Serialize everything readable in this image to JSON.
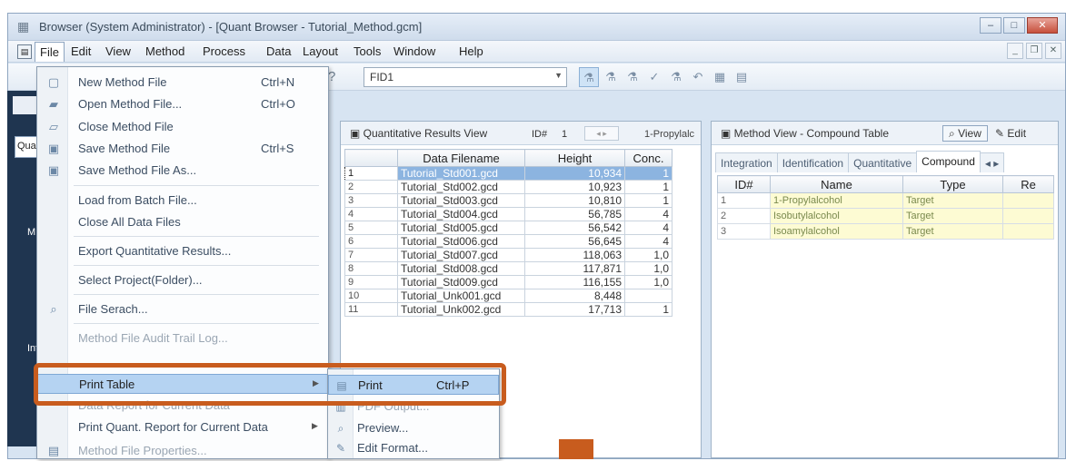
{
  "window": {
    "title": "Browser (System Administrator) - [Quant Browser - Tutorial_Method.gcm]"
  },
  "menubar": [
    "File",
    "Edit",
    "View",
    "Method",
    "Process",
    "Data",
    "Layout",
    "Tools",
    "Window",
    "Help"
  ],
  "toolbar": {
    "detector_value": "FID1"
  },
  "left_panel": {
    "labels": [
      "Qua",
      "M",
      "Int"
    ]
  },
  "results_view": {
    "title": "Quantitative Results View",
    "id_label": "ID#",
    "id_value": "1",
    "target": "1-Propylalc",
    "columns": [
      "Data Filename",
      "Height",
      "Conc."
    ],
    "rows": [
      {
        "n": "1",
        "file": "Tutorial_Std001.gcd",
        "height": "10,934",
        "conc": "1"
      },
      {
        "n": "2",
        "file": "Tutorial_Std002.gcd",
        "height": "10,923",
        "conc": "1"
      },
      {
        "n": "3",
        "file": "Tutorial_Std003.gcd",
        "height": "10,810",
        "conc": "1"
      },
      {
        "n": "4",
        "file": "Tutorial_Std004.gcd",
        "height": "56,785",
        "conc": "4"
      },
      {
        "n": "5",
        "file": "Tutorial_Std005.gcd",
        "height": "56,542",
        "conc": "4"
      },
      {
        "n": "6",
        "file": "Tutorial_Std006.gcd",
        "height": "56,645",
        "conc": "4"
      },
      {
        "n": "7",
        "file": "Tutorial_Std007.gcd",
        "height": "118,063",
        "conc": "1,0"
      },
      {
        "n": "8",
        "file": "Tutorial_Std008.gcd",
        "height": "117,871",
        "conc": "1,0"
      },
      {
        "n": "9",
        "file": "Tutorial_Std009.gcd",
        "height": "116,155",
        "conc": "1,0"
      },
      {
        "n": "10",
        "file": "Tutorial_Unk001.gcd",
        "height": "8,448",
        "conc": ""
      },
      {
        "n": "11",
        "file": "Tutorial_Unk002.gcd",
        "height": "17,713",
        "conc": "1"
      }
    ]
  },
  "method_view": {
    "title": "Method View - Compound Table",
    "view_label": "View",
    "edit_label": "Edit",
    "tabs": [
      "Integration",
      "Identification",
      "Quantitative",
      "Compound"
    ],
    "columns": [
      "ID#",
      "Name",
      "Type",
      "Re"
    ],
    "rows": [
      {
        "n": "1",
        "name": "1-Propylalcohol",
        "type": "Target"
      },
      {
        "n": "2",
        "name": "Isobutylalcohol",
        "type": "Target"
      },
      {
        "n": "3",
        "name": "Isoamylalcohol",
        "type": "Target"
      }
    ]
  },
  "file_menu": {
    "items": [
      {
        "label": "New Method File",
        "shortcut": "Ctrl+N"
      },
      {
        "label": "Open Method File...",
        "shortcut": "Ctrl+O"
      },
      {
        "label": "Close Method File",
        "shortcut": ""
      },
      {
        "label": "Save Method File",
        "shortcut": "Ctrl+S"
      },
      {
        "label": "Save Method File As...",
        "shortcut": ""
      },
      {
        "label": "Load from Batch File...",
        "shortcut": ""
      },
      {
        "label": "Close All Data Files",
        "shortcut": ""
      },
      {
        "label": "Export Quantitative Results...",
        "shortcut": ""
      },
      {
        "label": "Select Project(Folder)...",
        "shortcut": ""
      },
      {
        "label": "File Serach...",
        "shortcut": ""
      },
      {
        "label": "Method File Audit Trail Log...",
        "shortcut": ""
      },
      {
        "label": "Print Table",
        "shortcut": ""
      },
      {
        "label": "Data Report for Current Data",
        "shortcut": ""
      },
      {
        "label": "Print Quant. Report for Current Data",
        "shortcut": ""
      },
      {
        "label": "Method File Properties...",
        "shortcut": ""
      }
    ]
  },
  "print_submenu": {
    "items": [
      {
        "label": "Print",
        "shortcut": "Ctrl+P"
      },
      {
        "label": "PDF Output...",
        "shortcut": ""
      },
      {
        "label": "Preview...",
        "shortcut": ""
      },
      {
        "label": "Edit Format...",
        "shortcut": ""
      }
    ]
  },
  "colors": {
    "highlight_box": "#c85c1e",
    "selection": "#b5d3f2",
    "compound_row": "#fdfbd3"
  }
}
